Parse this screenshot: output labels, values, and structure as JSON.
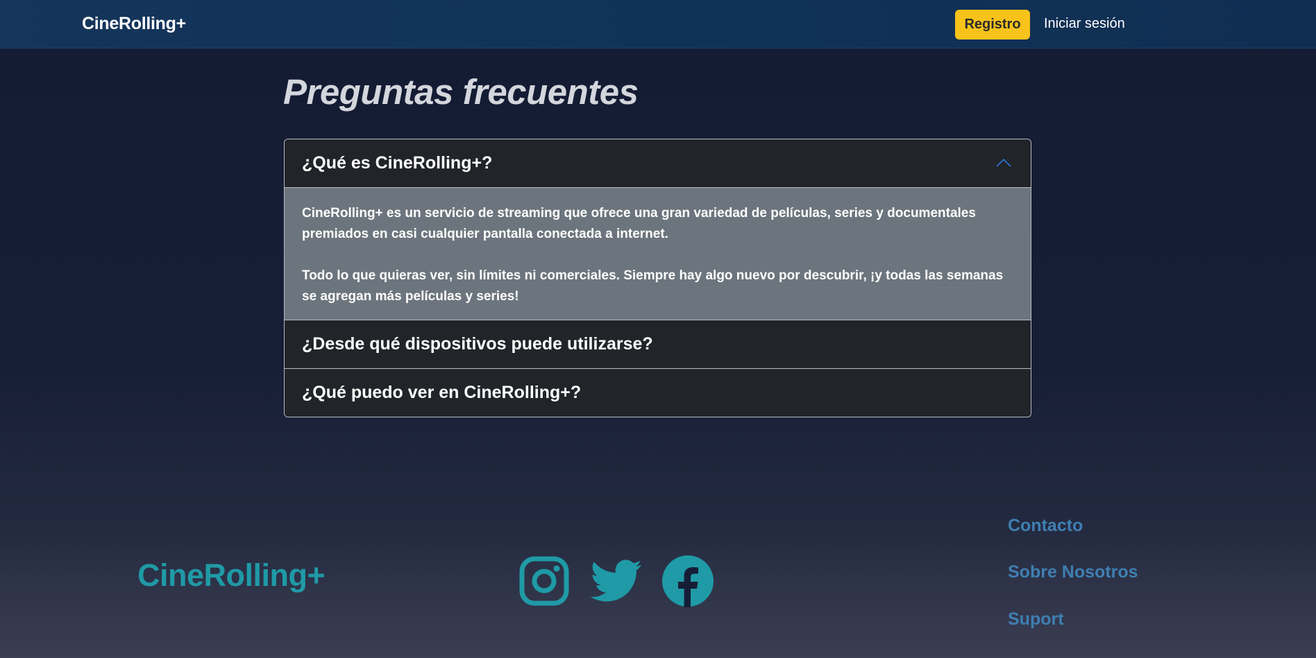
{
  "header": {
    "brand": "CineRolling+",
    "register_label": "Registro",
    "login_label": "Iniciar sesión"
  },
  "faq": {
    "title": "Preguntas frecuentes",
    "items": [
      {
        "question": "¿Qué es CineRolling+?",
        "expanded": true,
        "answer": [
          "CineRolling+ es un servicio de streaming que ofrece una gran variedad de películas, series y documentales premiados en casi cualquier pantalla conectada a internet.",
          "Todo lo que quieras ver, sin límites ni comerciales. Siempre hay algo nuevo por descubrir, ¡y todas las semanas se agregan más películas y series!"
        ]
      },
      {
        "question": "¿Desde qué dispositivos puede utilizarse?",
        "expanded": false
      },
      {
        "question": "¿Qué puedo ver en CineRolling+?",
        "expanded": false
      }
    ]
  },
  "footer": {
    "brand": "CineRolling+",
    "social_icons": [
      "instagram-icon",
      "twitter-icon",
      "facebook-icon"
    ],
    "links": [
      "Contacto",
      "Sobre Nosotros",
      "Suport"
    ]
  },
  "colors": {
    "header_bg": "#0f3358",
    "register_button": "#f7c21a",
    "accordion_body": "#6c757d",
    "footer_accent": "#1f9aa6",
    "footer_links": "#3f7fb1"
  }
}
